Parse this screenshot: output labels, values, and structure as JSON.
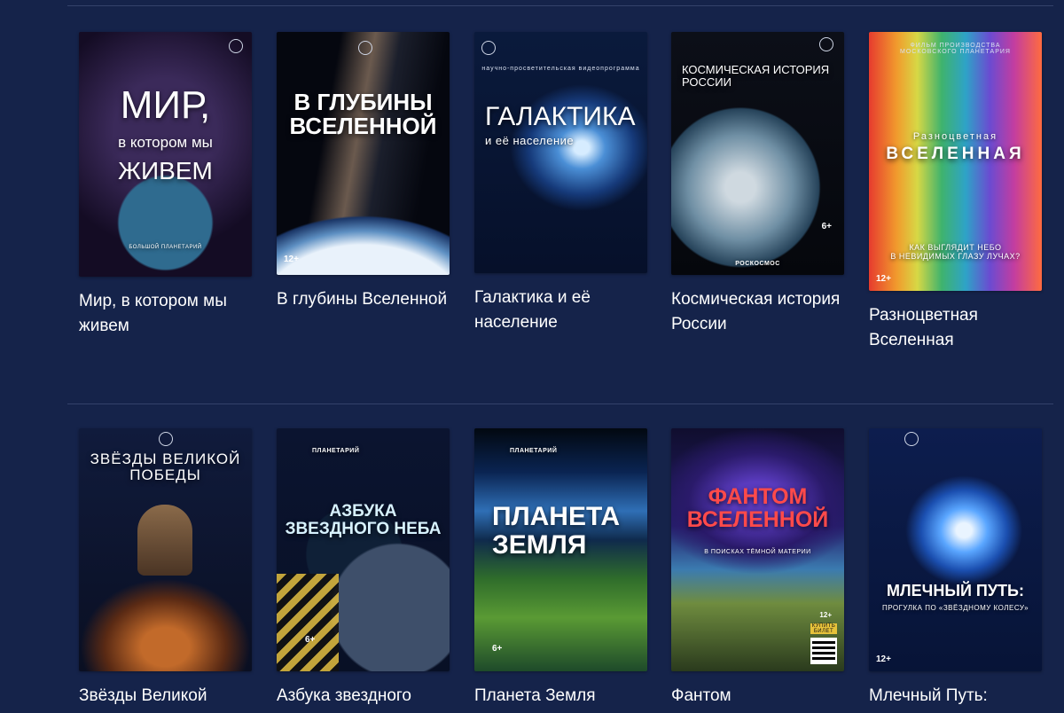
{
  "rows": [
    {
      "cards": [
        {
          "title": "Мир, в котором мы живем",
          "poster": {
            "line1": "МИР,",
            "line2": "в котором мы",
            "line3": "ЖИВЕМ",
            "footer": "БОЛЬШОЙ ПЛАНЕТАРИЙ"
          }
        },
        {
          "title": "В глубины Вселенной",
          "poster": {
            "headline": "В  ГЛУБИНЫ\nВСЕЛЕННОЙ",
            "age": "12+"
          }
        },
        {
          "title": "Галактика и её население",
          "poster": {
            "tagline": "научно-просветительская видеопрограмма",
            "headline": "ГАЛАКТИКА",
            "sub": "и её население"
          }
        },
        {
          "title": "Космическая история России",
          "poster": {
            "headline": "КОСМИЧЕСКАЯ ИСТОРИЯ\nРОССИИ",
            "age": "6+",
            "sponsor": "РОСКОСМОС"
          }
        },
        {
          "title": "Разноцветная Вселенная",
          "poster": {
            "tagline": "ФИЛЬМ ПРОИЗВОДСТВА\nМОСКОВСКОГО ПЛАНЕТАРИЯ",
            "sub": "Разноцветная",
            "headline": "ВСЕЛЕННАЯ",
            "question": "КАК ВЫГЛЯДИТ НЕБО\nВ НЕВИДИМЫХ ГЛАЗУ ЛУЧАХ?",
            "age": "12+"
          }
        }
      ]
    },
    {
      "cards": [
        {
          "title": "Звёзды Великой",
          "poster": {
            "headline": "ЗВЁЗДЫ ВЕЛИКОЙ\nПОБЕДЫ"
          }
        },
        {
          "title": "Азбука звездного",
          "poster": {
            "brand": "ПЛАНЕТАРИЙ",
            "headline": "АЗБУКА\nЗВЕЗДНОГО НЕБА",
            "age": "6+"
          }
        },
        {
          "title": "Планета Земля",
          "poster": {
            "brand": "ПЛАНЕТАРИЙ",
            "headline": "ПЛАНЕТА\nЗЕМЛЯ",
            "age": "6+"
          }
        },
        {
          "title": "Фантом",
          "poster": {
            "headline": "ФАНТОМ\nВСЕЛЕННОЙ",
            "sub": "В ПОИСКАХ ТЁМНОЙ МАТЕРИИ",
            "age": "12+",
            "ticket": "КУПИТЬ БИЛЕТ"
          }
        },
        {
          "title": "Млечный Путь:",
          "poster": {
            "headline": "МЛЕЧНЫЙ ПУТЬ:",
            "sub": "ПРОГУЛКА ПО «ЗВЁЗДНОМУ КОЛЕСУ»",
            "age": "12+"
          }
        }
      ]
    }
  ],
  "colors": {
    "background": "#15234a",
    "divider": "#34426a",
    "text": "#ffffff"
  }
}
